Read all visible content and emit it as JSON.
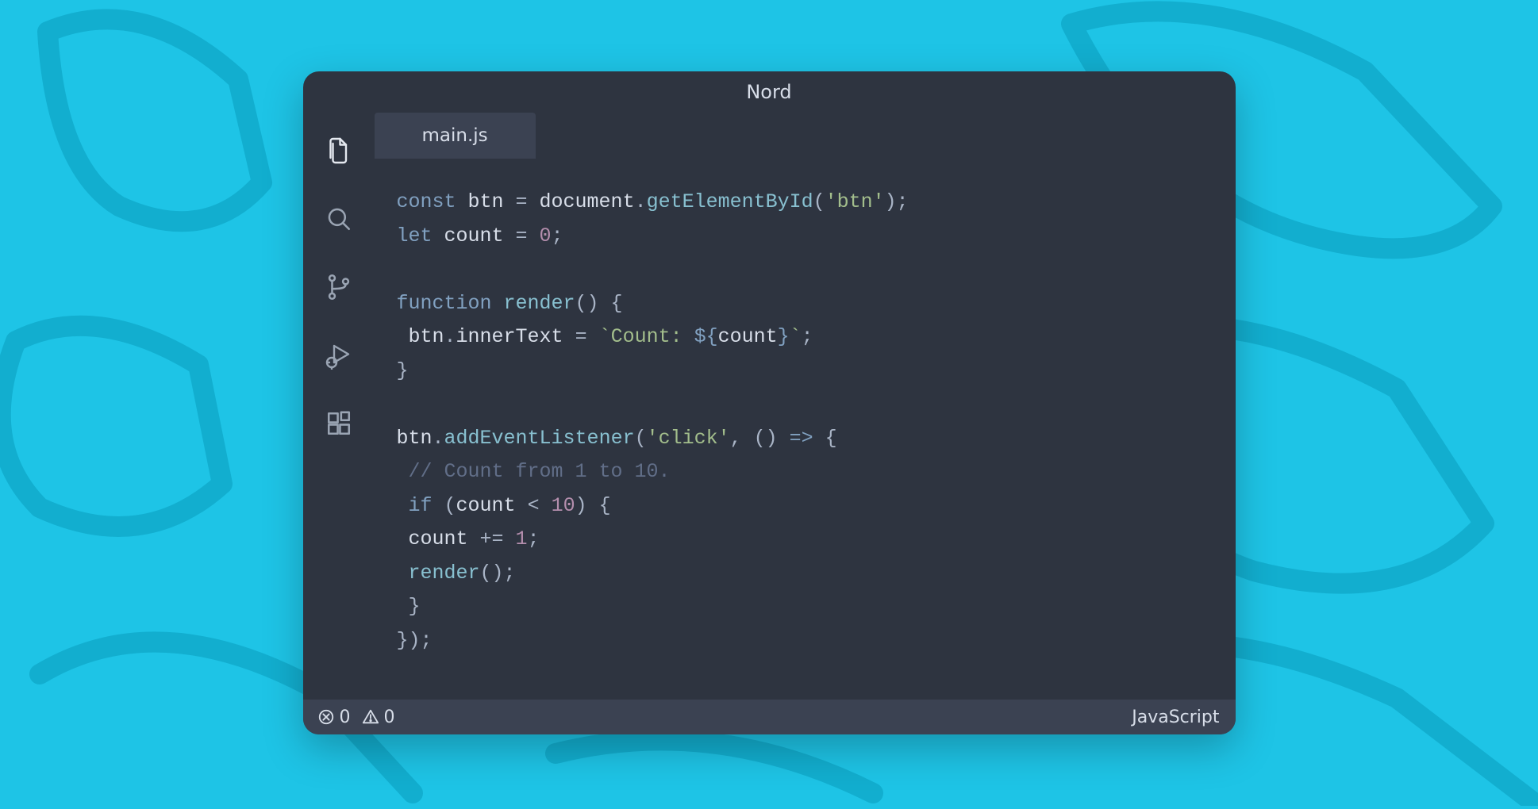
{
  "theme": {
    "name": "Nord",
    "bg": "#2e3440",
    "tab_bg": "#3b4252",
    "status_bg": "#3b4252",
    "fg": "#d8dee9",
    "keyword": "#81a1c1",
    "function": "#88c0d0",
    "string": "#a3be8c",
    "number": "#b48ead",
    "comment": "#616e88"
  },
  "titlebar": {
    "title": "Nord"
  },
  "activity_bar": {
    "items": [
      {
        "name": "explorer",
        "icon": "files-icon",
        "active": true
      },
      {
        "name": "search",
        "icon": "search-icon",
        "active": false
      },
      {
        "name": "source-control",
        "icon": "git-branch-icon",
        "active": false
      },
      {
        "name": "run-debug",
        "icon": "debug-icon",
        "active": false
      },
      {
        "name": "extensions",
        "icon": "extensions-icon",
        "active": false
      }
    ]
  },
  "tabs": [
    {
      "label": "main.js",
      "active": true
    }
  ],
  "code": {
    "lines": [
      [
        {
          "c": "kw",
          "t": "const "
        },
        {
          "c": "id",
          "t": "btn "
        },
        {
          "c": "pun",
          "t": "= "
        },
        {
          "c": "id",
          "t": "document"
        },
        {
          "c": "pun",
          "t": "."
        },
        {
          "c": "fn",
          "t": "getElementById"
        },
        {
          "c": "pun",
          "t": "("
        },
        {
          "c": "str",
          "t": "'btn'"
        },
        {
          "c": "pun",
          "t": ");"
        }
      ],
      [
        {
          "c": "kw",
          "t": "let "
        },
        {
          "c": "id",
          "t": "count "
        },
        {
          "c": "pun",
          "t": "= "
        },
        {
          "c": "num",
          "t": "0"
        },
        {
          "c": "pun",
          "t": ";"
        }
      ],
      [],
      [
        {
          "c": "kw",
          "t": "function "
        },
        {
          "c": "fn",
          "t": "render"
        },
        {
          "c": "pun",
          "t": "() {"
        }
      ],
      [
        {
          "c": "id",
          "t": " btn"
        },
        {
          "c": "pun",
          "t": "."
        },
        {
          "c": "id",
          "t": "innerText "
        },
        {
          "c": "pun",
          "t": "= "
        },
        {
          "c": "tpl",
          "t": "`Count: "
        },
        {
          "c": "kw",
          "t": "${"
        },
        {
          "c": "id",
          "t": "count"
        },
        {
          "c": "kw",
          "t": "}"
        },
        {
          "c": "tpl",
          "t": "`"
        },
        {
          "c": "pun",
          "t": ";"
        }
      ],
      [
        {
          "c": "pun",
          "t": "}"
        }
      ],
      [],
      [
        {
          "c": "id",
          "t": "btn"
        },
        {
          "c": "pun",
          "t": "."
        },
        {
          "c": "fn",
          "t": "addEventListener"
        },
        {
          "c": "pun",
          "t": "("
        },
        {
          "c": "str",
          "t": "'click'"
        },
        {
          "c": "pun",
          "t": ", () "
        },
        {
          "c": "kw",
          "t": "=>"
        },
        {
          "c": "pun",
          "t": " {"
        }
      ],
      [
        {
          "c": "com",
          "t": " // Count from 1 to 10."
        }
      ],
      [
        {
          "c": "pun",
          "t": " "
        },
        {
          "c": "kw",
          "t": "if "
        },
        {
          "c": "pun",
          "t": "("
        },
        {
          "c": "id",
          "t": "count "
        },
        {
          "c": "pun",
          "t": "< "
        },
        {
          "c": "num",
          "t": "10"
        },
        {
          "c": "pun",
          "t": ") {"
        }
      ],
      [
        {
          "c": "id",
          "t": " count "
        },
        {
          "c": "pun",
          "t": "+= "
        },
        {
          "c": "num",
          "t": "1"
        },
        {
          "c": "pun",
          "t": ";"
        }
      ],
      [
        {
          "c": "pun",
          "t": " "
        },
        {
          "c": "fn",
          "t": "render"
        },
        {
          "c": "pun",
          "t": "();"
        }
      ],
      [
        {
          "c": "pun",
          "t": " }"
        }
      ],
      [
        {
          "c": "pun",
          "t": "});"
        }
      ]
    ]
  },
  "statusbar": {
    "errors": "0",
    "warnings": "0",
    "language": "JavaScript"
  }
}
